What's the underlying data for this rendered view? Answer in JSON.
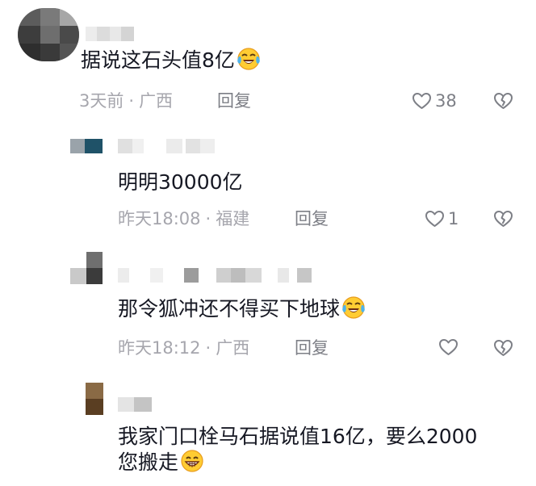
{
  "icons": {
    "like": "heart-outline-icon",
    "dislike": "broken-heart-icon",
    "laugh_cry": "face-with-tears-of-joy-emoji",
    "grin": "grinning-face-emoji"
  },
  "comments": [
    {
      "text": "据说这石头值8亿",
      "emoji": "face-with-tears-of-joy-emoji",
      "time": "3天前",
      "location": "广西",
      "reply_label": "回复",
      "like_count": "38"
    },
    {
      "text": "明明30000亿",
      "time": "昨天18:08",
      "location": "福建",
      "reply_label": "回复",
      "like_count": "1"
    },
    {
      "text": "那令狐冲还不得买下地球",
      "emoji": "face-with-tears-of-joy-emoji",
      "time": "昨天18:12",
      "location": "广西",
      "reply_label": "回复",
      "like_count": ""
    },
    {
      "text": "我家门口栓马石据说值16亿，要么2000您搬走",
      "emoji": "grinning-face-emoji"
    }
  ]
}
